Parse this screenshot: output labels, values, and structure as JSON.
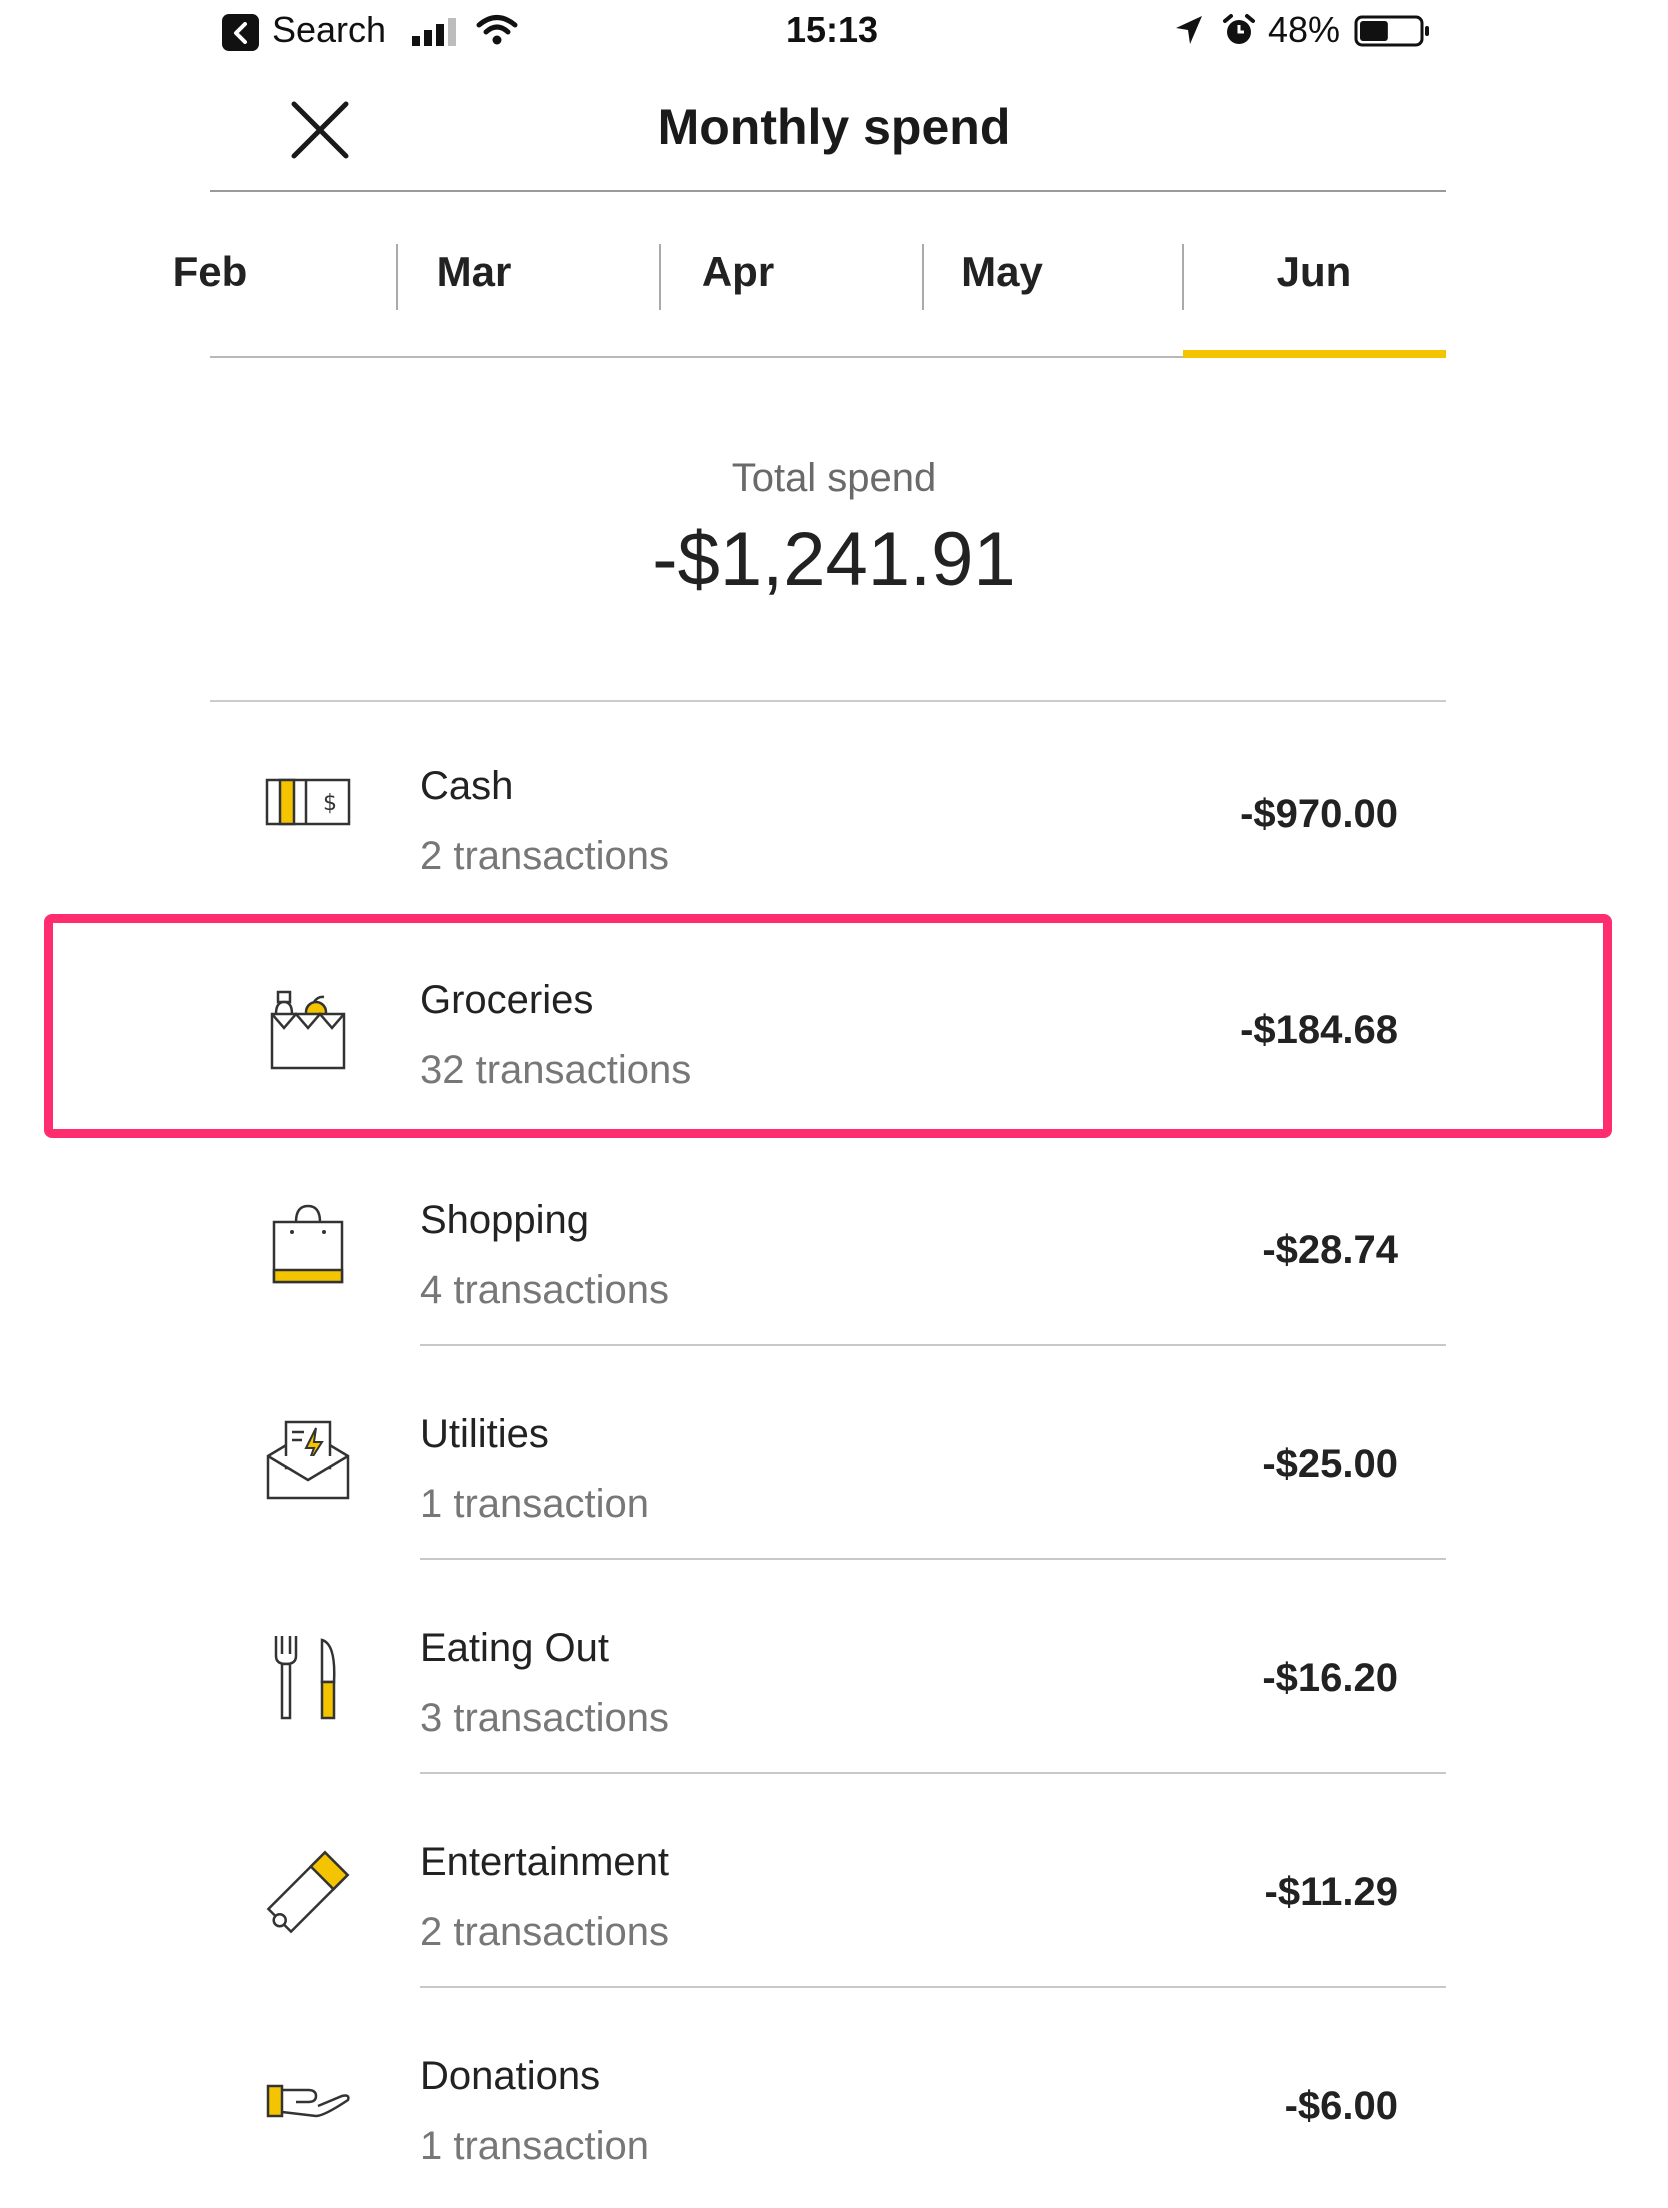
{
  "status_bar": {
    "back_label": "Search",
    "time": "15:13",
    "battery_percent": "48%",
    "battery_level": 0.48
  },
  "header": {
    "title": "Monthly spend"
  },
  "tabs": [
    {
      "label": "Feb",
      "active": false
    },
    {
      "label": "Mar",
      "active": false
    },
    {
      "label": "Apr",
      "active": false
    },
    {
      "label": "May",
      "active": false
    },
    {
      "label": "Jun",
      "active": true
    }
  ],
  "summary": {
    "label": "Total spend",
    "value": "-$1,241.91"
  },
  "categories": [
    {
      "name": "Cash",
      "count": "2 transactions",
      "amount": "-$970.00",
      "icon": "cash-icon"
    },
    {
      "name": "Groceries",
      "count": "32 transactions",
      "amount": "-$184.68",
      "icon": "groceries-icon",
      "highlighted": true
    },
    {
      "name": "Shopping",
      "count": "4 transactions",
      "amount": "-$28.74",
      "icon": "shopping-bag-icon"
    },
    {
      "name": "Utilities",
      "count": "1 transaction",
      "amount": "-$25.00",
      "icon": "utilities-bill-icon"
    },
    {
      "name": "Eating Out",
      "count": "3 transactions",
      "amount": "-$16.20",
      "icon": "fork-knife-icon"
    },
    {
      "name": "Entertainment",
      "count": "2 transactions",
      "amount": "-$11.29",
      "icon": "ticket-icon"
    },
    {
      "name": "Donations",
      "count": "1 transaction",
      "amount": "-$6.00",
      "icon": "giving-hand-icon"
    }
  ],
  "colors": {
    "accent": "#f5c400",
    "highlight_border": "#ff2d6f"
  }
}
